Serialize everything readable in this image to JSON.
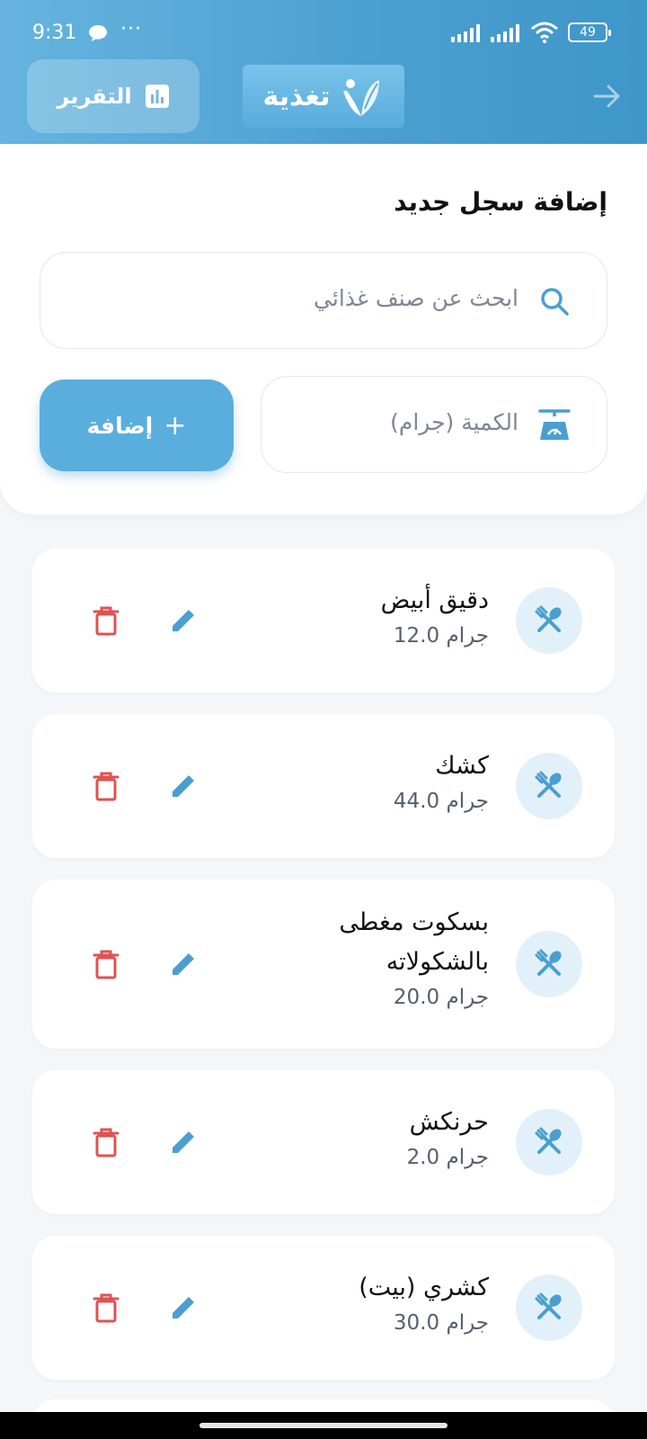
{
  "status": {
    "time": "9:31",
    "dots": "···",
    "battery": "49"
  },
  "header": {
    "report_label": "التقرير",
    "logo_text": "تغذية",
    "colors": {
      "primary": "#4a9fd0",
      "accent": "#5aaedd",
      "danger": "#e05252"
    }
  },
  "add_form": {
    "title": "إضافة سجل جديد",
    "search_placeholder": "ابحث عن صنف غذائي",
    "quantity_placeholder": "الكمية (جرام)",
    "add_label": "إضافة",
    "add_symbol": "+"
  },
  "items": [
    {
      "name": "دقيق أبيض",
      "quantity": "12.0 جرام"
    },
    {
      "name": "كشك",
      "quantity": "44.0 جرام"
    },
    {
      "name": "بسكوت مغطى",
      "name_line2": "بالشكولاته",
      "quantity": "20.0 جرام"
    },
    {
      "name": "حرنكش",
      "quantity": "2.0 جرام"
    },
    {
      "name": "كشري (بيت)",
      "quantity": "30.0 جرام"
    }
  ],
  "icons": {
    "search": "search-icon",
    "scale": "scale-icon",
    "food": "utensils-icon",
    "edit": "pencil-icon",
    "delete": "trash-icon",
    "report": "bar-chart-icon",
    "back": "arrow-right-icon"
  }
}
